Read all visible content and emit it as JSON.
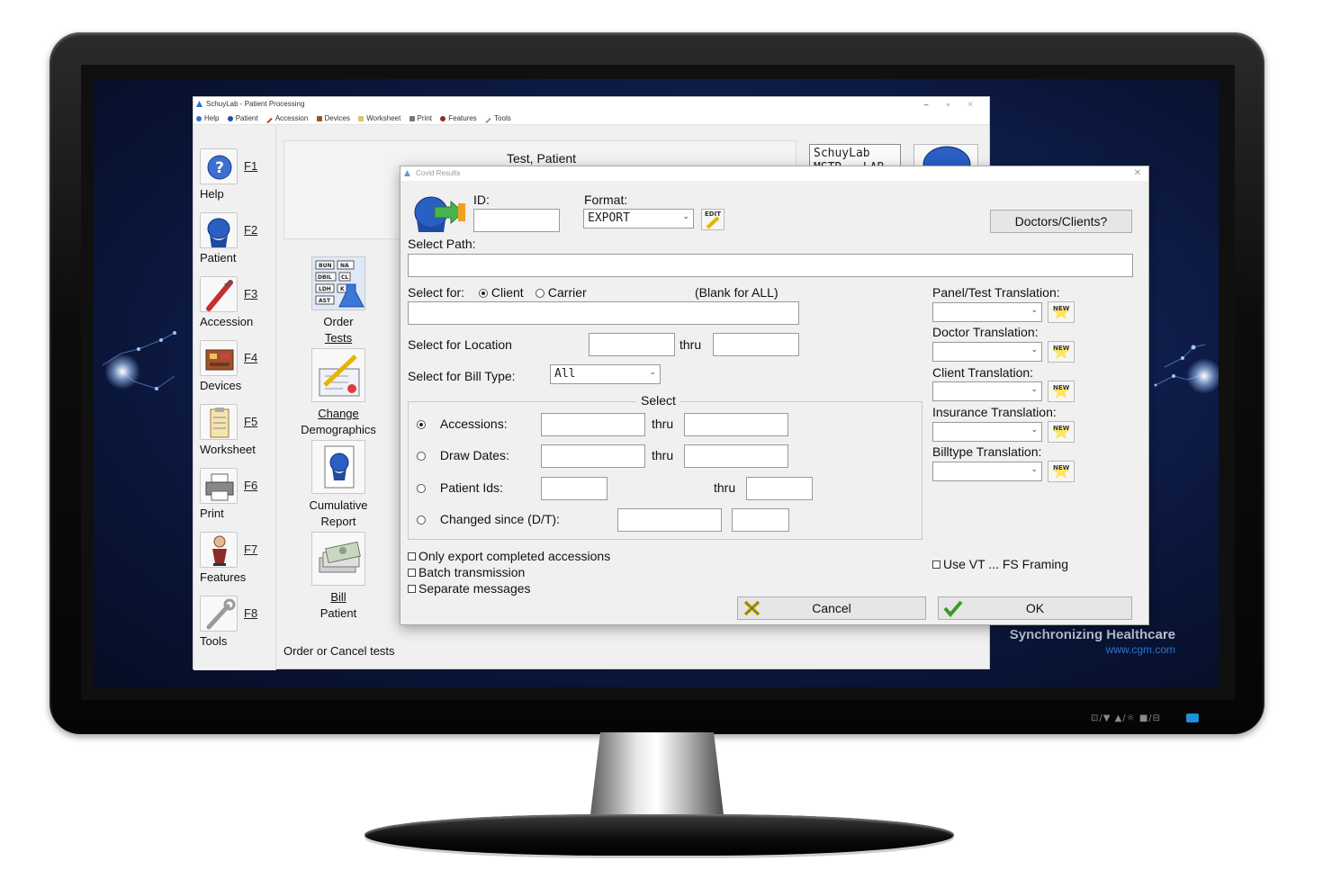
{
  "app": {
    "title": "SchuyLab - Patient Processing",
    "window_controls": [
      "–",
      "▫",
      "✕"
    ],
    "menu": [
      "Help",
      "Patient",
      "Accession",
      "Devices",
      "Worksheet",
      "Print",
      "Features",
      "Tools"
    ],
    "patient_name": "Test, Patient",
    "schuylab_box": "SchuyLab\nMSTR - LAB",
    "status_text": "Order or Cancel tests",
    "fkeys": [
      {
        "code": "F1",
        "label": "Help"
      },
      {
        "code": "F2",
        "label": "Patient"
      },
      {
        "code": "F3",
        "label": "Accession"
      },
      {
        "code": "F4",
        "label": "Devices"
      },
      {
        "code": "F5",
        "label": "Worksheet"
      },
      {
        "code": "F6",
        "label": "Print"
      },
      {
        "code": "F7",
        "label": "Features"
      },
      {
        "code": "F8",
        "label": "Tools"
      }
    ],
    "actions": [
      {
        "line1": "Order",
        "line2": "Tests"
      },
      {
        "line1": "Change",
        "line2": "Demographics"
      },
      {
        "line1": "Cumulative",
        "line2": "Report"
      },
      {
        "line1": "Bill",
        "line2": "Patient"
      }
    ],
    "order_icon_labels": [
      "BUN",
      "NA",
      "DBIL",
      "CL",
      "LDH",
      "K",
      "AST"
    ]
  },
  "dialog": {
    "title": "Covid Results",
    "close": "✕",
    "id_label": "ID:",
    "id_value": "",
    "format_label": "Format:",
    "format_value": "EXPORT",
    "edit_label": "EDIT",
    "doctors_button": "Doctors/Clients?",
    "select_path_label": "Select Path:",
    "select_path_value": "",
    "select_for_label": "Select for:",
    "client_label": "Client",
    "carrier_label": "Carrier",
    "blank_note": "(Blank for ALL)",
    "select_for_location_label": "Select for Location",
    "thru": "thru",
    "select_bill_type_label": "Select for Bill Type:",
    "bill_type_value": "All",
    "select_group_title": "Select",
    "accessions_label": "Accessions:",
    "draw_dates_label": "Draw Dates:",
    "patient_ids_label": "Patient Ids:",
    "changed_since_label": "Changed since (D/T):",
    "only_export_label": "Only export completed accessions",
    "batch_label": "Batch transmission",
    "separate_label": "Separate messages",
    "use_vt_label": "Use VT ... FS Framing",
    "translations": [
      "Panel/Test Translation:",
      "Doctor Translation:",
      "Client Translation:",
      "Insurance Translation:",
      "Billtype Translation:"
    ],
    "new_label": "NEW",
    "cancel_button": "Cancel",
    "ok_button": "OK"
  },
  "branding": {
    "name": "Synchronizing Healthcare",
    "url": "www.cgm.com"
  },
  "bezel": {
    "controls": "⊡/▼ ▲/☼ ■/⊟"
  },
  "colors": {
    "accent_blue": "#2f6fd1",
    "brand_url": "#2d73c9",
    "screen_bg": "#12245a",
    "ok_check": "#3a9a2a",
    "cancel_x": "#c8b400"
  }
}
